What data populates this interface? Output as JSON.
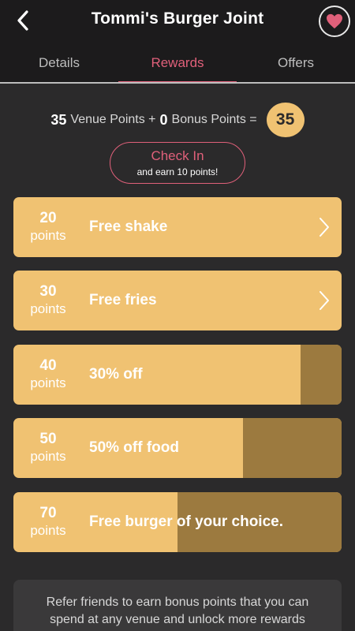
{
  "header": {
    "title": "Tommi's Burger Joint",
    "back_icon": "chevron-left-icon",
    "favorite_icon": "heart-icon",
    "accent_color": "#e0607a"
  },
  "tabs": [
    {
      "label": "Details",
      "active": false
    },
    {
      "label": "Rewards",
      "active": true
    },
    {
      "label": "Offers",
      "active": false
    }
  ],
  "points_summary": {
    "venue_points": "35",
    "venue_label": "Venue Points +",
    "bonus_points": "0",
    "bonus_label": "Bonus Points =",
    "total": "35"
  },
  "checkin": {
    "label": "Check In",
    "sublabel": "and earn 10 points!"
  },
  "rewards": [
    {
      "points": "20",
      "unit": "points",
      "name": "Free shake",
      "progress": 1.0,
      "unlocked": true
    },
    {
      "points": "30",
      "unit": "points",
      "name": "Free fries",
      "progress": 1.0,
      "unlocked": true
    },
    {
      "points": "40",
      "unit": "points",
      "name": "30% off",
      "progress": 0.875,
      "unlocked": false
    },
    {
      "points": "50",
      "unit": "points",
      "name": "50% off food",
      "progress": 0.7,
      "unlocked": false
    },
    {
      "points": "70",
      "unit": "points",
      "name": "Free burger of your choice.",
      "progress": 0.5,
      "unlocked": false
    }
  ],
  "refer": {
    "text": "Refer friends to earn bonus points that you can spend at any venue and unlock more rewards"
  },
  "colors": {
    "reward_bg": "#f0c272",
    "reward_locked": "#9c7a3f",
    "total_badge": "#f0c272"
  }
}
